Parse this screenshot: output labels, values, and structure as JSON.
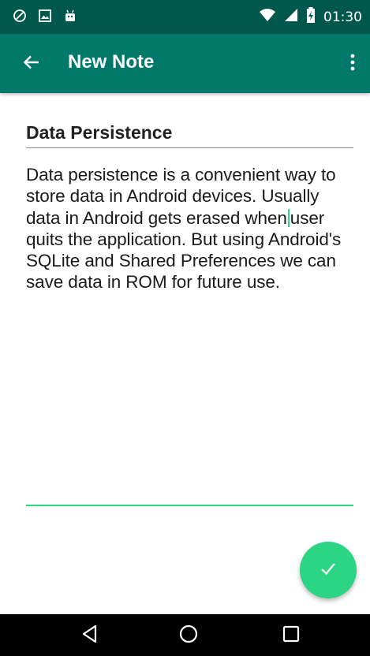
{
  "status_bar": {
    "time": "01:30",
    "left_icons": [
      "do-not-disturb-icon",
      "image-icon",
      "android-debug-icon"
    ],
    "right_icons": [
      "wifi-icon",
      "cell-signal-icon",
      "battery-charging-icon"
    ]
  },
  "app_bar": {
    "title": "New Note",
    "back_icon": "arrow-back-icon",
    "menu_icon": "more-vert-icon"
  },
  "note": {
    "title_value": "Data Persistence",
    "body_before_cursor": "Data persistence is a convenient way to store data in Android devices. Usually data in Android gets erased when",
    "body_after_cursor": "user quits the application. But using Android's SQLite and Shared Preferences we can save data in ROM for future use."
  },
  "fab": {
    "icon": "check-icon"
  },
  "nav_bar": {
    "icons": [
      "back-triangle-icon",
      "home-circle-icon",
      "recents-square-icon"
    ]
  },
  "colors": {
    "status_bar": "#00574b",
    "app_bar": "#00796b",
    "accent": "#2bd584"
  }
}
